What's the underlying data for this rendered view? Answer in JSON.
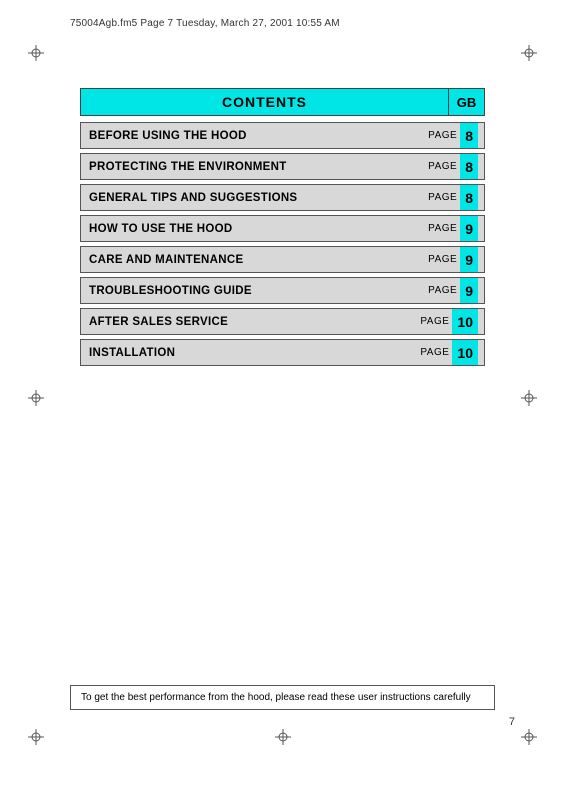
{
  "fileInfo": "75004Agb.fm5  Page 7  Tuesday, March 27, 2001  10:55 AM",
  "header": {
    "title": "CONTENTS",
    "gb": "GB"
  },
  "tocItems": [
    {
      "label": "BEFORE USING THE HOOD",
      "pageWord": "PAGE",
      "pageNum": "8"
    },
    {
      "label": "PROTECTING THE ENVIRONMENT",
      "pageWord": "PAGE",
      "pageNum": "8"
    },
    {
      "label": "GENERAL TIPS AND SUGGESTIONS",
      "pageWord": "PAGE",
      "pageNum": "8"
    },
    {
      "label": "HOW TO USE THE HOOD",
      "pageWord": "PAGE",
      "pageNum": "9"
    },
    {
      "label": "CARE AND MAINTENANCE",
      "pageWord": "PAGE",
      "pageNum": "9"
    },
    {
      "label": "TROUBLESHOOTING GUIDE",
      "pageWord": "PAGE",
      "pageNum": "9"
    },
    {
      "label": "AFTER SALES SERVICE",
      "pageWord": "PAGE",
      "pageNum": "10"
    },
    {
      "label": "INSTALLATION",
      "pageWord": "PAGE",
      "pageNum": "10"
    }
  ],
  "bottomNote": "To get the best performance from the hood, please read these user instructions carefully",
  "pageNumber": "7"
}
